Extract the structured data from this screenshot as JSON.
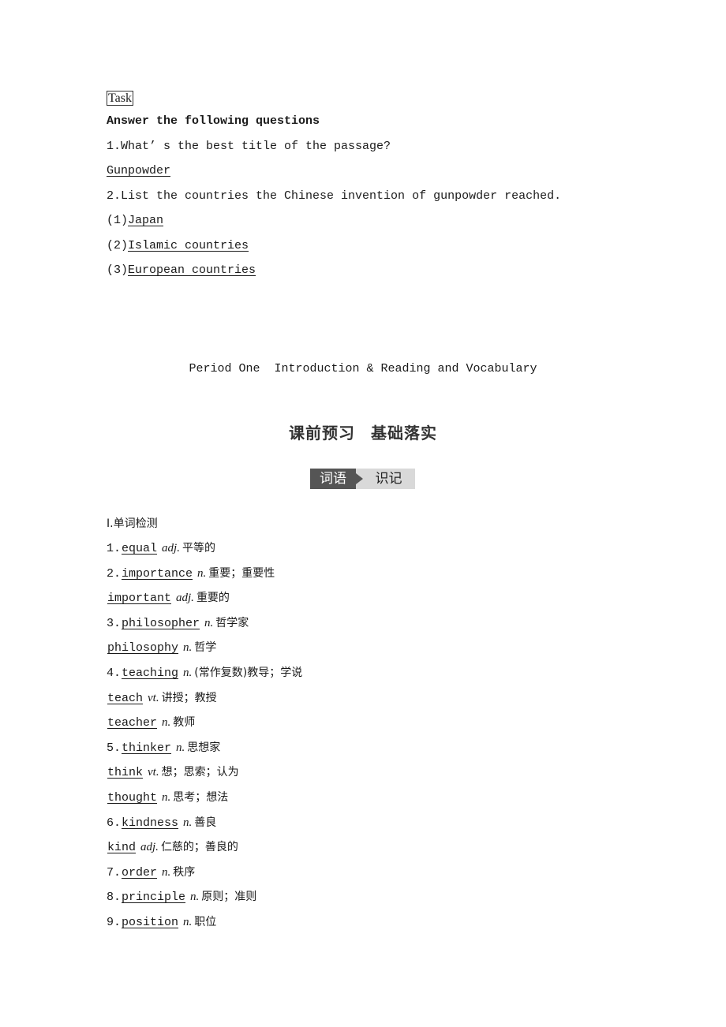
{
  "task": {
    "label": "Task",
    "heading": "Answer the following questions",
    "q1": {
      "text": "1.What’ s the best title of the passage?",
      "answer": "Gunpowder"
    },
    "q2": {
      "text": "2.List the countries the Chinese invention of gunpowder reached.",
      "answers": [
        {
          "num": "(1)",
          "value": "Japan"
        },
        {
          "num": "(2)",
          "value": "Islamic countries"
        },
        {
          "num": "(3)",
          "value": "European countries"
        }
      ]
    }
  },
  "period_title": "Period One  Introduction & Reading and Vocabulary",
  "section_title": {
    "left": "课前预习",
    "right": "基础落实"
  },
  "badge": {
    "left": "词语",
    "right": "识记"
  },
  "vocab": {
    "heading": "Ⅰ.单词检测",
    "items": [
      {
        "num": "1.",
        "word": "equal",
        "pos": "adj.",
        "meaning": "平等的"
      },
      {
        "num": "2.",
        "word": "importance",
        "pos": "n.",
        "meaning": "重要；重要性"
      },
      {
        "num": "",
        "word": "important",
        "pos": "adj.",
        "meaning": "重要的"
      },
      {
        "num": "3.",
        "word": "philosopher",
        "pos": "n.",
        "meaning": "哲学家"
      },
      {
        "num": "",
        "word": "philosophy",
        "pos": "n.",
        "meaning": "哲学"
      },
      {
        "num": "4.",
        "word": "teaching",
        "pos": "n.",
        "meaning": "(常作复数)教导；学说"
      },
      {
        "num": "",
        "word": "teach",
        "pos": "vt.",
        "meaning": "讲授；教授"
      },
      {
        "num": "",
        "word": "teacher",
        "pos": "n.",
        "meaning": "教师"
      },
      {
        "num": "5.",
        "word": "thinker",
        "pos": "n.",
        "meaning": "思想家"
      },
      {
        "num": "",
        "word": "think",
        "pos": "vt.",
        "meaning": "想；思索；认为"
      },
      {
        "num": "",
        "word": "thought",
        "pos": "n.",
        "meaning": "思考；想法"
      },
      {
        "num": "6.",
        "word": "kindness",
        "pos": "n.",
        "meaning": "善良"
      },
      {
        "num": "",
        "word": "kind",
        "pos": "adj.",
        "meaning": "仁慈的；善良的"
      },
      {
        "num": "7.",
        "word": "order",
        "pos": "n.",
        "meaning": "秩序"
      },
      {
        "num": "8.",
        "word": "principle",
        "pos": "n.",
        "meaning": "原则；准则"
      },
      {
        "num": "9.",
        "word": "position",
        "pos": "n.",
        "meaning": "职位"
      }
    ]
  }
}
